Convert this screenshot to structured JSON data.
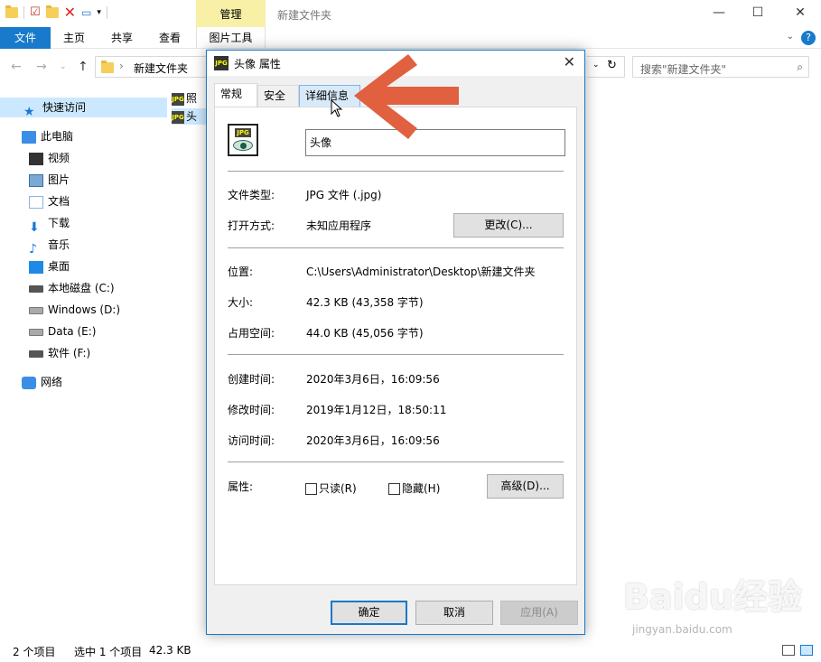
{
  "explorer": {
    "window_title": "新建文件夹",
    "context_tab": "管理",
    "ribbon_tabs": [
      "文件",
      "主页",
      "共享",
      "查看",
      "图片工具"
    ],
    "address_path": "新建文件夹",
    "search_placeholder": "搜索\"新建文件夹\"",
    "nav": {
      "quick_access": "快速访问",
      "this_pc": "此电脑",
      "videos": "视频",
      "pictures": "图片",
      "documents": "文档",
      "downloads": "下载",
      "music": "音乐",
      "desktop": "桌面",
      "drive_c": "本地磁盘 (C:)",
      "drive_d": "Windows (D:)",
      "drive_e": "Data (E:)",
      "drive_f": "软件 (F:)",
      "network": "网络"
    },
    "files": [
      {
        "name": "照"
      },
      {
        "name": "头"
      }
    ],
    "status": {
      "item_count": "2 个项目",
      "selected": "选中 1 个项目",
      "size": "42.3 KB"
    }
  },
  "dialog": {
    "title": "头像 属性",
    "tabs": [
      "常规",
      "安全",
      "详细信息"
    ],
    "active_tab": "常规",
    "file_name": "头像",
    "labels": {
      "file_type": "文件类型:",
      "open_with": "打开方式:",
      "location": "位置:",
      "size": "大小:",
      "size_on_disk": "占用空间:",
      "created": "创建时间:",
      "modified": "修改时间:",
      "accessed": "访问时间:",
      "attributes": "属性:"
    },
    "values": {
      "file_type": "JPG 文件 (.jpg)",
      "open_with": "未知应用程序",
      "location": "C:\\Users\\Administrator\\Desktop\\新建文件夹",
      "size": "42.3 KB (43,358 字节)",
      "size_on_disk": "44.0 KB (45,056 字节)",
      "created": "2020年3月6日，16:09:56",
      "modified": "2019年1月12日，18:50:11",
      "accessed": "2020年3月6日，16:09:56"
    },
    "buttons": {
      "change": "更改(C)...",
      "advanced": "高级(D)...",
      "ok": "确定",
      "cancel": "取消",
      "apply": "应用(A)"
    },
    "checkboxes": {
      "readonly": "只读(R)",
      "hidden": "隐藏(H)"
    }
  },
  "watermark": {
    "main": "Baidu经验",
    "sub": "jingyan.baidu.com"
  },
  "colors": {
    "accent": "#1979ca",
    "annotation_arrow": "#e06040",
    "context_tab_bg": "#f7f0a6",
    "selection": "#cce8ff"
  }
}
